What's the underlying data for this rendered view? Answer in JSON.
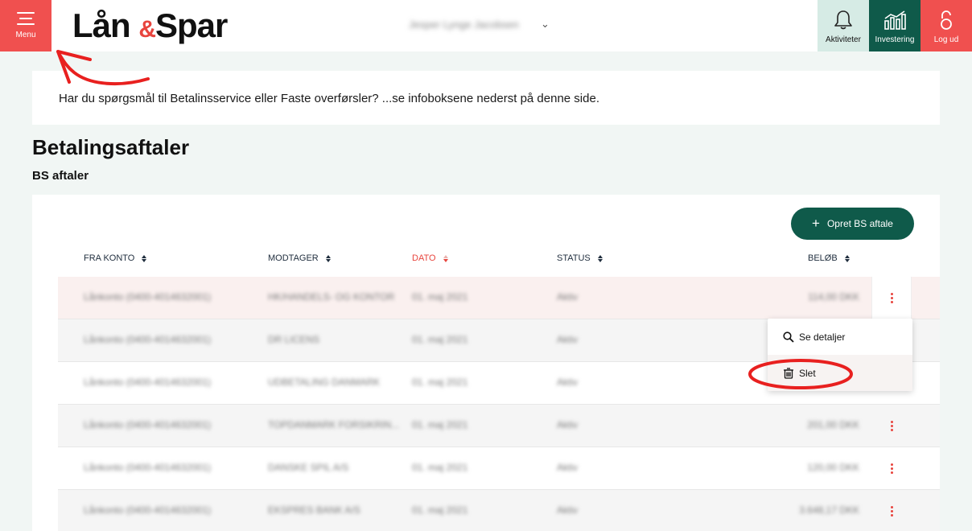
{
  "header": {
    "menu_label": "Menu",
    "logo": {
      "part1": "Lån",
      "amp": "&",
      "part2": "Spar"
    },
    "user_name": "Jesper Lynge Jacobsen",
    "user_chevron": "⌄",
    "buttons": [
      {
        "label": "Aktiviteter",
        "icon": "bell-icon"
      },
      {
        "label": "Investering",
        "icon": "chart-icon"
      },
      {
        "label": "Log ud",
        "icon": "lock-icon"
      }
    ]
  },
  "info_text": "Har du spørgsmål til Betalinsservice eller Faste overførsler? ...se infoboksene nederst på denne side.",
  "page_title": "Betalingsaftaler",
  "section_title": "BS aftaler",
  "create_button": {
    "plus": "+",
    "label": "Opret BS aftale"
  },
  "columns": [
    "FRA KONTO",
    "MODTAGER",
    "DATO",
    "STATUS",
    "BELØB"
  ],
  "rows": [
    {
      "account": "Lånkonto (0400-4014632001)",
      "recipient": "HK/HANDELS- OG KONTOR",
      "date": "01. maj 2021",
      "status": "Aktiv",
      "amount": "114,00 DKK"
    },
    {
      "account": "Lånkonto (0400-4014632001)",
      "recipient": "DR LICENS",
      "date": "01. maj 2021",
      "status": "Aktiv",
      "amount": ""
    },
    {
      "account": "Lånkonto (0400-4014632001)",
      "recipient": "UDBETALING DANMARK",
      "date": "01. maj 2021",
      "status": "Aktiv",
      "amount": ""
    },
    {
      "account": "Lånkonto (0400-4014632001)",
      "recipient": "TOPDANMARK FORSIKRIN...",
      "date": "01. maj 2021",
      "status": "Aktiv",
      "amount": "201,00 DKK"
    },
    {
      "account": "Lånkonto (0400-4014632001)",
      "recipient": "DANSKE SPIL A/S",
      "date": "01. maj 2021",
      "status": "Aktiv",
      "amount": "120,00 DKK"
    },
    {
      "account": "Lånkonto (0400-4014632001)",
      "recipient": "EKSPRES BANK A/S",
      "date": "01. maj 2021",
      "status": "Aktiv",
      "amount": "3.648,17 DKK"
    }
  ],
  "dropdown": {
    "details": "Se detaljer",
    "delete": "Slet"
  },
  "colors": {
    "brand_red": "#f0504f",
    "brand_green": "#0f5a4a",
    "annotation": "#e8201f"
  }
}
